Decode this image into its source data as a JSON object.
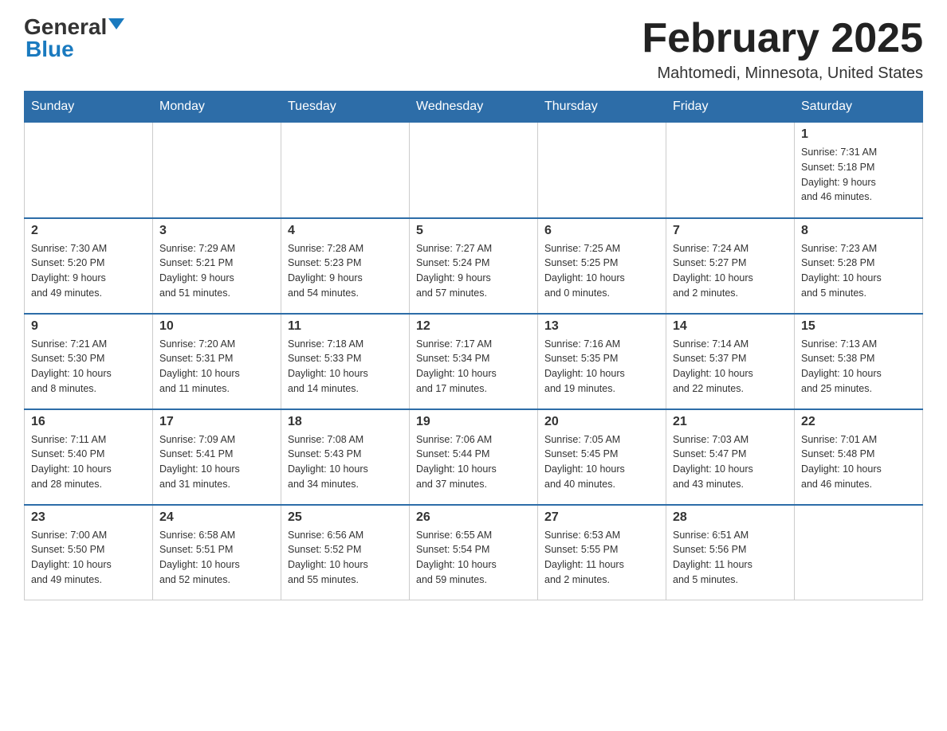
{
  "header": {
    "logo_general": "General",
    "logo_blue": "Blue",
    "month_title": "February 2025",
    "location": "Mahtomedi, Minnesota, United States"
  },
  "weekdays": [
    "Sunday",
    "Monday",
    "Tuesday",
    "Wednesday",
    "Thursday",
    "Friday",
    "Saturday"
  ],
  "weeks": [
    [
      {
        "day": "",
        "info": ""
      },
      {
        "day": "",
        "info": ""
      },
      {
        "day": "",
        "info": ""
      },
      {
        "day": "",
        "info": ""
      },
      {
        "day": "",
        "info": ""
      },
      {
        "day": "",
        "info": ""
      },
      {
        "day": "1",
        "info": "Sunrise: 7:31 AM\nSunset: 5:18 PM\nDaylight: 9 hours\nand 46 minutes."
      }
    ],
    [
      {
        "day": "2",
        "info": "Sunrise: 7:30 AM\nSunset: 5:20 PM\nDaylight: 9 hours\nand 49 minutes."
      },
      {
        "day": "3",
        "info": "Sunrise: 7:29 AM\nSunset: 5:21 PM\nDaylight: 9 hours\nand 51 minutes."
      },
      {
        "day": "4",
        "info": "Sunrise: 7:28 AM\nSunset: 5:23 PM\nDaylight: 9 hours\nand 54 minutes."
      },
      {
        "day": "5",
        "info": "Sunrise: 7:27 AM\nSunset: 5:24 PM\nDaylight: 9 hours\nand 57 minutes."
      },
      {
        "day": "6",
        "info": "Sunrise: 7:25 AM\nSunset: 5:25 PM\nDaylight: 10 hours\nand 0 minutes."
      },
      {
        "day": "7",
        "info": "Sunrise: 7:24 AM\nSunset: 5:27 PM\nDaylight: 10 hours\nand 2 minutes."
      },
      {
        "day": "8",
        "info": "Sunrise: 7:23 AM\nSunset: 5:28 PM\nDaylight: 10 hours\nand 5 minutes."
      }
    ],
    [
      {
        "day": "9",
        "info": "Sunrise: 7:21 AM\nSunset: 5:30 PM\nDaylight: 10 hours\nand 8 minutes."
      },
      {
        "day": "10",
        "info": "Sunrise: 7:20 AM\nSunset: 5:31 PM\nDaylight: 10 hours\nand 11 minutes."
      },
      {
        "day": "11",
        "info": "Sunrise: 7:18 AM\nSunset: 5:33 PM\nDaylight: 10 hours\nand 14 minutes."
      },
      {
        "day": "12",
        "info": "Sunrise: 7:17 AM\nSunset: 5:34 PM\nDaylight: 10 hours\nand 17 minutes."
      },
      {
        "day": "13",
        "info": "Sunrise: 7:16 AM\nSunset: 5:35 PM\nDaylight: 10 hours\nand 19 minutes."
      },
      {
        "day": "14",
        "info": "Sunrise: 7:14 AM\nSunset: 5:37 PM\nDaylight: 10 hours\nand 22 minutes."
      },
      {
        "day": "15",
        "info": "Sunrise: 7:13 AM\nSunset: 5:38 PM\nDaylight: 10 hours\nand 25 minutes."
      }
    ],
    [
      {
        "day": "16",
        "info": "Sunrise: 7:11 AM\nSunset: 5:40 PM\nDaylight: 10 hours\nand 28 minutes."
      },
      {
        "day": "17",
        "info": "Sunrise: 7:09 AM\nSunset: 5:41 PM\nDaylight: 10 hours\nand 31 minutes."
      },
      {
        "day": "18",
        "info": "Sunrise: 7:08 AM\nSunset: 5:43 PM\nDaylight: 10 hours\nand 34 minutes."
      },
      {
        "day": "19",
        "info": "Sunrise: 7:06 AM\nSunset: 5:44 PM\nDaylight: 10 hours\nand 37 minutes."
      },
      {
        "day": "20",
        "info": "Sunrise: 7:05 AM\nSunset: 5:45 PM\nDaylight: 10 hours\nand 40 minutes."
      },
      {
        "day": "21",
        "info": "Sunrise: 7:03 AM\nSunset: 5:47 PM\nDaylight: 10 hours\nand 43 minutes."
      },
      {
        "day": "22",
        "info": "Sunrise: 7:01 AM\nSunset: 5:48 PM\nDaylight: 10 hours\nand 46 minutes."
      }
    ],
    [
      {
        "day": "23",
        "info": "Sunrise: 7:00 AM\nSunset: 5:50 PM\nDaylight: 10 hours\nand 49 minutes."
      },
      {
        "day": "24",
        "info": "Sunrise: 6:58 AM\nSunset: 5:51 PM\nDaylight: 10 hours\nand 52 minutes."
      },
      {
        "day": "25",
        "info": "Sunrise: 6:56 AM\nSunset: 5:52 PM\nDaylight: 10 hours\nand 55 minutes."
      },
      {
        "day": "26",
        "info": "Sunrise: 6:55 AM\nSunset: 5:54 PM\nDaylight: 10 hours\nand 59 minutes."
      },
      {
        "day": "27",
        "info": "Sunrise: 6:53 AM\nSunset: 5:55 PM\nDaylight: 11 hours\nand 2 minutes."
      },
      {
        "day": "28",
        "info": "Sunrise: 6:51 AM\nSunset: 5:56 PM\nDaylight: 11 hours\nand 5 minutes."
      },
      {
        "day": "",
        "info": ""
      }
    ]
  ]
}
